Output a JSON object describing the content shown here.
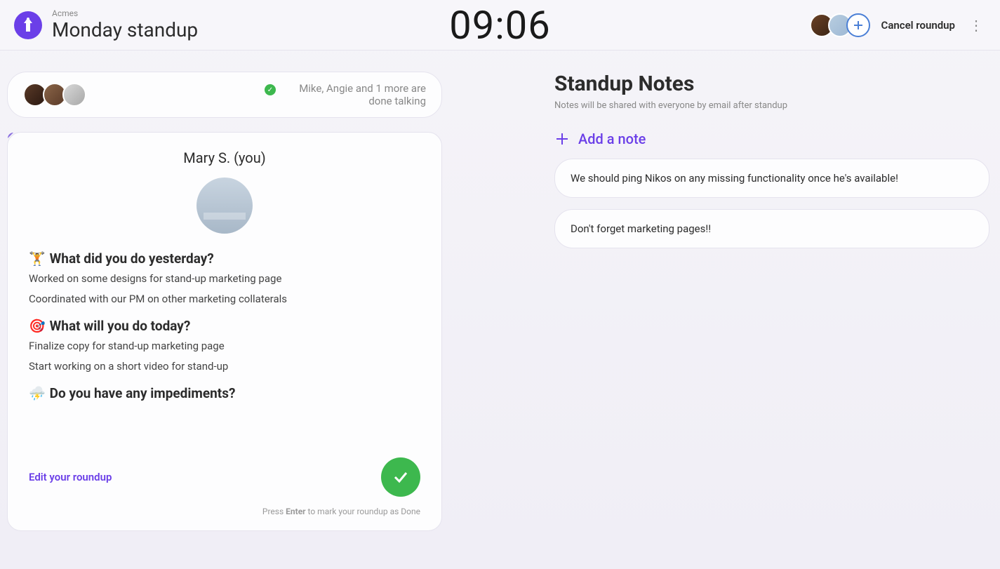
{
  "header": {
    "org": "Acmes",
    "title": "Monday standup",
    "timer": "09:06",
    "cancel": "Cancel roundup"
  },
  "done_banner": {
    "text": "Mike, Angie and 1 more are done talking"
  },
  "roundup": {
    "speaker": "Mary S. (you)",
    "q1_emoji": "🏋️",
    "q1": "What did you do yesterday?",
    "q1_a1": "Worked on some designs for stand-up marketing page",
    "q1_a2": "Coordinated with our PM on other marketing collaterals",
    "q2_emoji": "🎯",
    "q2": "What will you do today?",
    "q2_a1": "Finalize copy for stand-up marketing page",
    "q2_a2": "Start working on a short video for stand-up",
    "q3_emoji": "⛈️",
    "q3": "Do you have any impediments?",
    "edit": "Edit your roundup",
    "hint_pre": "Press ",
    "hint_key": "Enter",
    "hint_post": " to mark your roundup as Done"
  },
  "notes": {
    "title": "Standup Notes",
    "subtitle": "Notes will be shared with everyone by email after standup",
    "add": "Add a note",
    "items": [
      "We should ping Nikos on any missing functionality once he's available!",
      "Don't forget marketing pages!!"
    ]
  }
}
